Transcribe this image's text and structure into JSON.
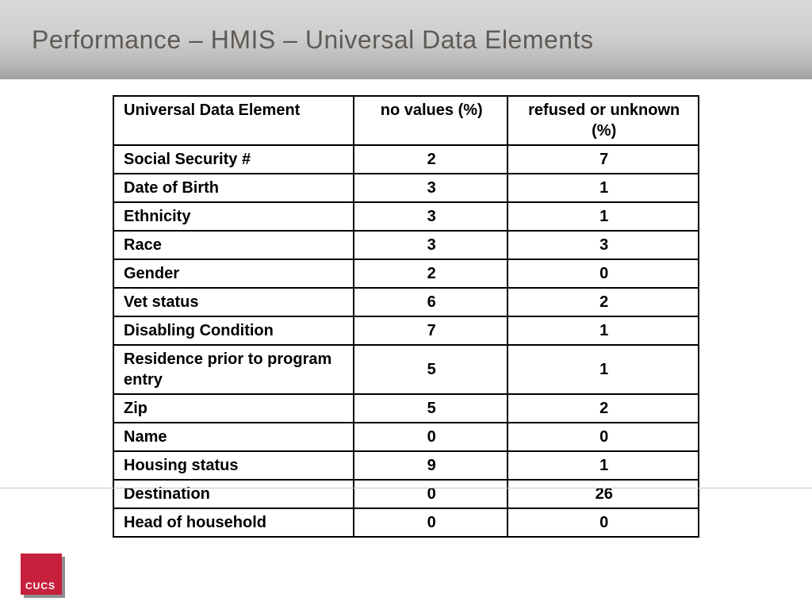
{
  "title": "Performance – HMIS – Universal Data Elements",
  "table": {
    "headers": {
      "c0": "Universal Data Element",
      "c1": "no values (%)",
      "c2": "refused or unknown (%)"
    },
    "rows": [
      {
        "label": "Social Security #",
        "nv": "2",
        "ru": "7"
      },
      {
        "label": "Date of Birth",
        "nv": "3",
        "ru": "1"
      },
      {
        "label": "Ethnicity",
        "nv": "3",
        "ru": "1"
      },
      {
        "label": "Race",
        "nv": "3",
        "ru": "3"
      },
      {
        "label": "Gender",
        "nv": "2",
        "ru": "0"
      },
      {
        "label": "Vet status",
        "nv": "6",
        "ru": "2"
      },
      {
        "label": "Disabling Condition",
        "nv": "7",
        "ru": "1"
      },
      {
        "label": "Residence prior to program entry",
        "nv": "5",
        "ru": "1"
      },
      {
        "label": "Zip",
        "nv": "5",
        "ru": "2"
      },
      {
        "label": "Name",
        "nv": "0",
        "ru": "0"
      },
      {
        "label": "Housing status",
        "nv": "9",
        "ru": "1"
      },
      {
        "label": "Destination",
        "nv": "0",
        "ru": "26"
      },
      {
        "label": "Head of household",
        "nv": "0",
        "ru": "0"
      }
    ]
  },
  "logo_text": "CUCS",
  "chart_data": {
    "type": "table",
    "title": "Performance – HMIS – Universal Data Elements",
    "columns": [
      "Universal Data Element",
      "no values (%)",
      "refused or unknown (%)"
    ],
    "rows": [
      [
        "Social Security #",
        2,
        7
      ],
      [
        "Date of Birth",
        3,
        1
      ],
      [
        "Ethnicity",
        3,
        1
      ],
      [
        "Race",
        3,
        3
      ],
      [
        "Gender",
        2,
        0
      ],
      [
        "Vet status",
        6,
        2
      ],
      [
        "Disabling Condition",
        7,
        1
      ],
      [
        "Residence prior to program entry",
        5,
        1
      ],
      [
        "Zip",
        5,
        2
      ],
      [
        "Name",
        0,
        0
      ],
      [
        "Housing status",
        9,
        1
      ],
      [
        "Destination",
        0,
        26
      ],
      [
        "Head of household",
        0,
        0
      ]
    ]
  }
}
